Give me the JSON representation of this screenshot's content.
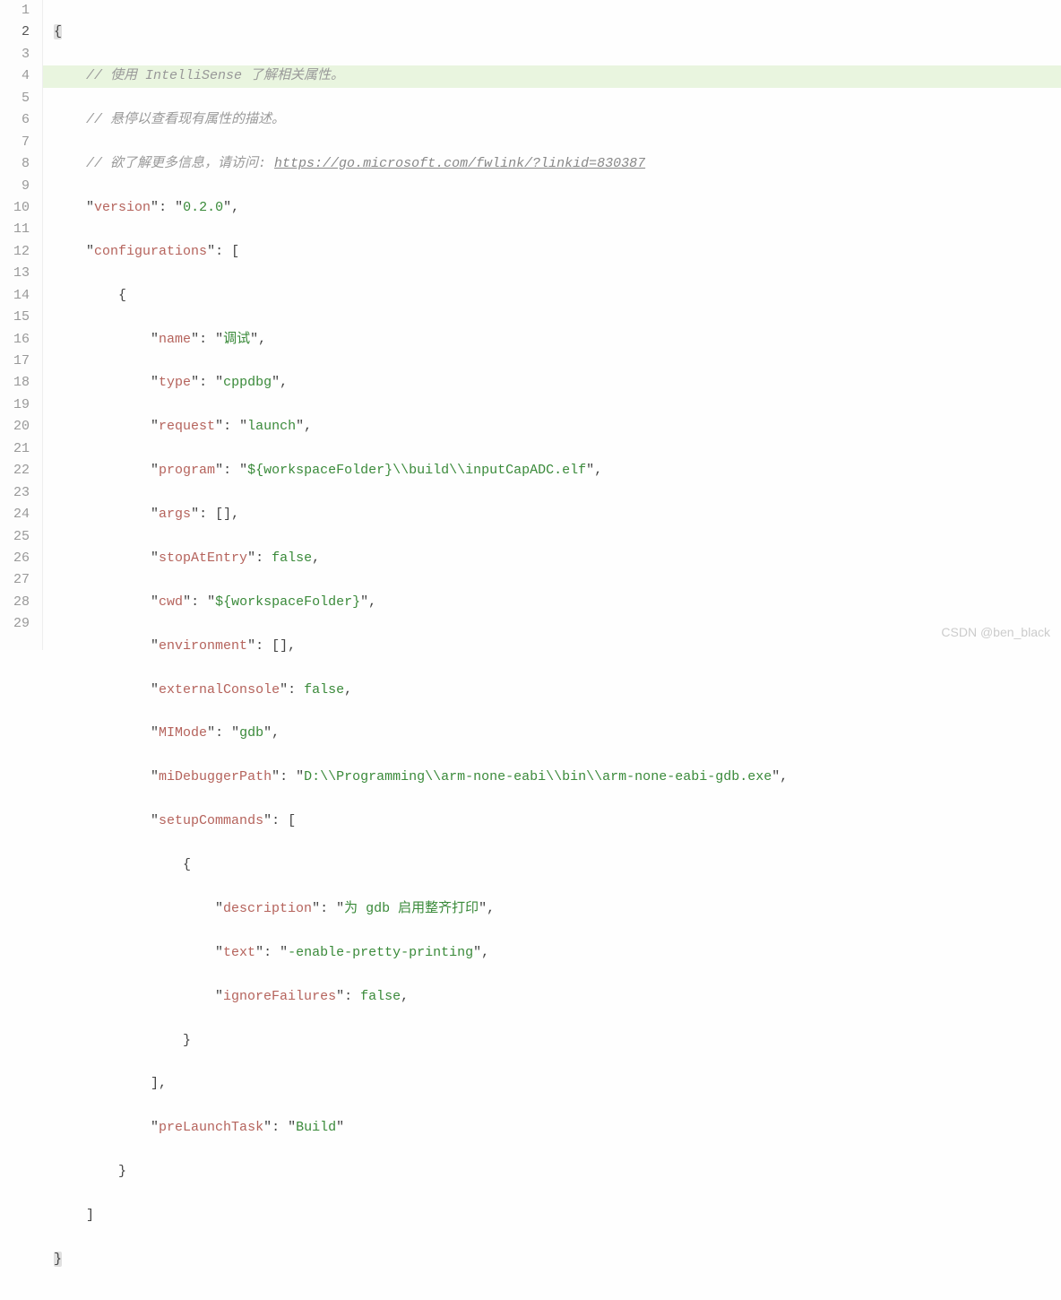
{
  "watermark": "CSDN @ben_black",
  "highlight_line": 2,
  "comments": {
    "c1": "使用 IntelliSense 了解相关属性。",
    "c2": "悬停以查看现有属性的描述。",
    "c3_prefix": "欲了解更多信息，请访问: ",
    "c3_link": "https://go.microsoft.com/fwlink/?linkid=830387"
  },
  "json": {
    "version_key": "version",
    "version_val": "0.2.0",
    "configs_key": "configurations",
    "cfg": {
      "name_key": "name",
      "name_val": "调试",
      "type_key": "type",
      "type_val": "cppdbg",
      "request_key": "request",
      "request_val": "launch",
      "program_key": "program",
      "program_val": "${workspaceFolder}\\\\build\\\\inputCapADC.elf",
      "args_key": "args",
      "stopAtEntry_key": "stopAtEntry",
      "stopAtEntry_val": "false",
      "cwd_key": "cwd",
      "cwd_val": "${workspaceFolder}",
      "environment_key": "environment",
      "externalConsole_key": "externalConsole",
      "externalConsole_val": "false",
      "MIMode_key": "MIMode",
      "MIMode_val": "gdb",
      "miDebuggerPath_key": "miDebuggerPath",
      "miDebuggerPath_val": "D:\\\\Programming\\\\arm-none-eabi\\\\bin\\\\arm-none-eabi-gdb.exe",
      "setupCommands_key": "setupCommands",
      "sc": {
        "description_key": "description",
        "description_val": "为 gdb 启用整齐打印",
        "text_key": "text",
        "text_val": "-enable-pretty-printing",
        "ignoreFailures_key": "ignoreFailures",
        "ignoreFailures_val": "false"
      },
      "preLaunchTask_key": "preLaunchTask",
      "preLaunchTask_val": "Build"
    }
  },
  "line_numbers": [
    "1",
    "2",
    "3",
    "4",
    "5",
    "6",
    "7",
    "8",
    "9",
    "10",
    "11",
    "12",
    "13",
    "14",
    "15",
    "16",
    "17",
    "18",
    "19",
    "20",
    "21",
    "22",
    "23",
    "24",
    "25",
    "26",
    "27",
    "28",
    "29"
  ]
}
